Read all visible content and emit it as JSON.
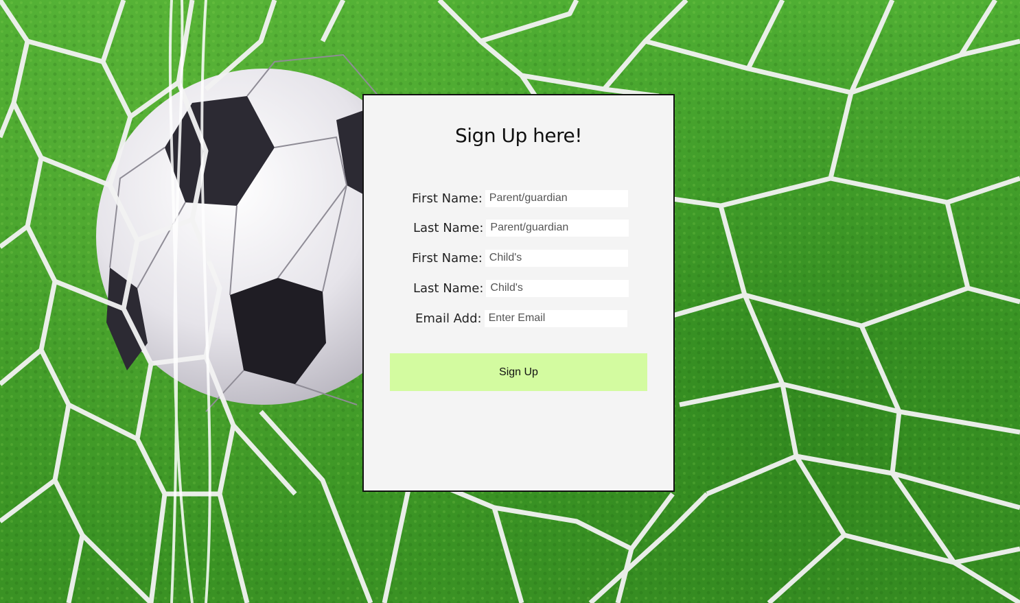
{
  "background": {
    "description_icon": "soccer-ball-in-net-icon",
    "grass_color": "#3f9a2a",
    "net_color": "#f2f2f2"
  },
  "form": {
    "title": "Sign Up here!",
    "fields": [
      {
        "label": "First Name:",
        "placeholder": "Parent/guardian",
        "value": ""
      },
      {
        "label": "Last Name:",
        "placeholder": "Parent/guardian",
        "value": ""
      },
      {
        "label": "First Name:",
        "placeholder": "Child's",
        "value": ""
      },
      {
        "label": "Last Name:",
        "placeholder": "Child's",
        "value": ""
      },
      {
        "label": "Email Add:",
        "placeholder": "Enter Email",
        "value": ""
      }
    ],
    "submit_label": "Sign Up",
    "submit_color": "#d3fba0",
    "card_color": "#f4f4f4"
  }
}
